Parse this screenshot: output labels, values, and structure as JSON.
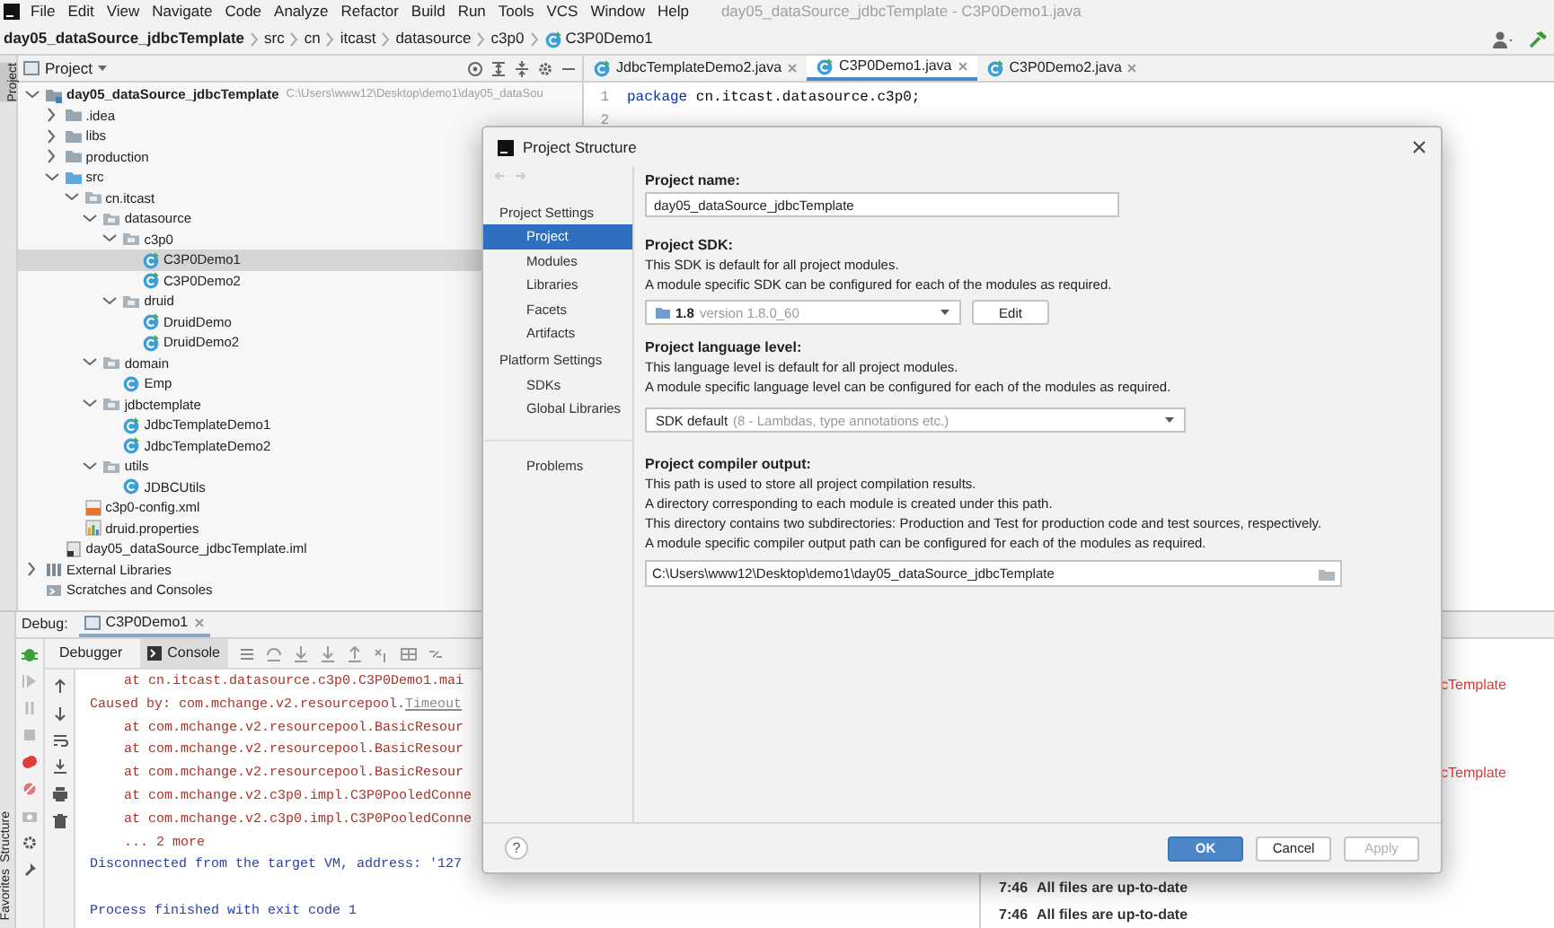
{
  "menu_bar": {
    "items": [
      "File",
      "Edit",
      "View",
      "Navigate",
      "Code",
      "Analyze",
      "Refactor",
      "Build",
      "Run",
      "Tools",
      "VCS",
      "Window",
      "Help"
    ],
    "title": "day05_dataSource_jdbcTemplate - C3P0Demo1.java"
  },
  "breadcrumb": [
    "day05_dataSource_jdbcTemplate",
    "src",
    "cn",
    "itcast",
    "datasource",
    "c3p0",
    "C3P0Demo1"
  ],
  "side_tabs": {
    "top": "Project",
    "bottom": [
      "Structure",
      "Favorites"
    ]
  },
  "project_panel": {
    "title": "Project",
    "tree": [
      {
        "label": "day05_dataSource_jdbcTemplate",
        "path": "C:\\Users\\www12\\Desktop\\demo1\\day05_dataSou",
        "kind": "module",
        "expanded": true,
        "selected": false,
        "children": [
          {
            "label": ".idea",
            "kind": "folder",
            "expanded": false,
            "selected": false
          },
          {
            "label": "libs",
            "kind": "folder",
            "expanded": false,
            "selected": false
          },
          {
            "label": "production",
            "kind": "folder",
            "expanded": false,
            "selected": false
          },
          {
            "label": "src",
            "kind": "source",
            "expanded": true,
            "selected": false,
            "children": [
              {
                "label": "cn.itcast",
                "kind": "package",
                "expanded": true,
                "selected": false,
                "children": [
                  {
                    "label": "datasource",
                    "kind": "package",
                    "expanded": true,
                    "selected": false,
                    "children": [
                      {
                        "label": "c3p0",
                        "kind": "package",
                        "expanded": true,
                        "selected": false,
                        "children": [
                          {
                            "label": "C3P0Demo1",
                            "kind": "main-class",
                            "selected": true
                          },
                          {
                            "label": "C3P0Demo2",
                            "kind": "main-class",
                            "selected": false
                          }
                        ]
                      },
                      {
                        "label": "druid",
                        "kind": "package",
                        "expanded": true,
                        "selected": false,
                        "children": [
                          {
                            "label": "DruidDemo",
                            "kind": "main-class",
                            "selected": false
                          },
                          {
                            "label": "DruidDemo2",
                            "kind": "main-class",
                            "selected": false
                          }
                        ]
                      }
                    ]
                  },
                  {
                    "label": "domain",
                    "kind": "package",
                    "expanded": true,
                    "selected": false,
                    "children": [
                      {
                        "label": "Emp",
                        "kind": "class",
                        "selected": false
                      }
                    ]
                  },
                  {
                    "label": "jdbctemplate",
                    "kind": "package",
                    "expanded": true,
                    "selected": false,
                    "children": [
                      {
                        "label": "JdbcTemplateDemo1",
                        "kind": "main-class",
                        "selected": false
                      },
                      {
                        "label": "JdbcTemplateDemo2",
                        "kind": "main-class",
                        "selected": false
                      }
                    ]
                  },
                  {
                    "label": "utils",
                    "kind": "package",
                    "expanded": true,
                    "selected": false,
                    "children": [
                      {
                        "label": "JDBCUtils",
                        "kind": "class",
                        "selected": false
                      }
                    ]
                  }
                ]
              },
              {
                "label": "c3p0-config.xml",
                "kind": "xml",
                "selected": false
              },
              {
                "label": "druid.properties",
                "kind": "properties",
                "selected": false
              }
            ]
          },
          {
            "label": "day05_dataSource_jdbcTemplate.iml",
            "kind": "iml",
            "selected": false
          }
        ]
      },
      {
        "label": "External Libraries",
        "kind": "library",
        "expanded": false,
        "selected": false
      },
      {
        "label": "Scratches and Consoles",
        "kind": "scratch",
        "selected": false
      }
    ]
  },
  "editor": {
    "tabs": [
      {
        "label": "JdbcTemplateDemo2.java",
        "selected": false
      },
      {
        "label": "C3P0Demo1.java",
        "selected": true
      },
      {
        "label": "C3P0Demo2.java",
        "selected": false
      }
    ],
    "lines": [
      {
        "number": "1",
        "parts": [
          {
            "kind": "keyword",
            "text": "package"
          },
          {
            "kind": "plain",
            "text": " cn.itcast.datasource.c3p0;"
          }
        ]
      },
      {
        "number": "2"
      }
    ]
  },
  "debug": {
    "title": "Debug:",
    "session": "C3P0Demo1",
    "tabs": [
      {
        "label": "Debugger",
        "selected": false
      },
      {
        "label": "Console",
        "selected": true
      }
    ],
    "console": [
      {
        "kind": "frame",
        "text": "at cn.itcast.datasource.c3p0.C3P0Demo1.mai"
      },
      {
        "kind": "error",
        "text": "Caused by: com.mchange.v2.resourcepool.",
        "link": "Timeout"
      },
      {
        "kind": "frame",
        "text": "at com.mchange.v2.resourcepool.BasicResour"
      },
      {
        "kind": "frame",
        "text": "at com.mchange.v2.resourcepool.BasicResour"
      },
      {
        "kind": "frame",
        "text": "at com.mchange.v2.resourcepool.BasicResour"
      },
      {
        "kind": "frame",
        "text": "at com.mchange.v2.c3p0.impl.C3P0PooledConne"
      },
      {
        "kind": "frame",
        "text": "at com.mchange.v2.c3p0.impl.C3P0PooledConne"
      },
      {
        "kind": "frame",
        "text": "... 2 more"
      },
      {
        "kind": "info",
        "text": "Disconnected from the target VM, address: '127"
      },
      {
        "kind": "info",
        "text": "Process finished with exit code 1"
      }
    ]
  },
  "event_log": {
    "fragments": [
      "cTemplate",
      "cTemplate"
    ],
    "entries": [
      {
        "time": "7:46",
        "text": "All files are up-to-date"
      },
      {
        "time": "7:46",
        "text": "All files are up-to-date"
      }
    ]
  },
  "dialog": {
    "title": "Project Structure",
    "nav_groups": [
      {
        "title": "Project Settings",
        "items": [
          {
            "label": "Project",
            "selected": true
          },
          {
            "label": "Modules",
            "selected": false
          },
          {
            "label": "Libraries",
            "selected": false
          },
          {
            "label": "Facets",
            "selected": false
          },
          {
            "label": "Artifacts",
            "selected": false
          }
        ]
      },
      {
        "title": "Platform Settings",
        "items": [
          {
            "label": "SDKs",
            "selected": false
          },
          {
            "label": "Global Libraries",
            "selected": false
          }
        ]
      },
      {
        "items": [
          {
            "label": "Problems",
            "selected": false
          }
        ]
      }
    ],
    "project_name": {
      "label": "Project name:",
      "value": "day05_dataSource_jdbcTemplate"
    },
    "sdk": {
      "label": "Project SDK:",
      "description": [
        "This SDK is default for all project modules.",
        "A module specific SDK can be configured for each of the modules as required."
      ],
      "value": "1.8",
      "detail": "version 1.8.0_60",
      "edit": "Edit"
    },
    "language_level": {
      "label": "Project language level:",
      "description": [
        "This language level is default for all project modules.",
        "A module specific language level can be configured for each of the modules as required."
      ],
      "value": "SDK default",
      "detail": "(8 - Lambdas, type annotations etc.)"
    },
    "compiler_output": {
      "label": "Project compiler output:",
      "description": [
        "This path is used to store all project compilation results.",
        "A directory corresponding to each module is created under this path.",
        "This directory contains two subdirectories: Production and Test for production code and test sources, respectively.",
        "A module specific compiler output path can be configured for each of the modules as required."
      ],
      "value": "C:\\Users\\www12\\Desktop\\demo1\\day05_dataSource_jdbcTemplate"
    },
    "help": "?",
    "buttons": [
      {
        "label": "OK",
        "kind": "primary",
        "disabled": false
      },
      {
        "label": "Cancel",
        "kind": "normal",
        "disabled": false
      },
      {
        "label": "Apply",
        "kind": "normal",
        "disabled": true
      }
    ]
  }
}
